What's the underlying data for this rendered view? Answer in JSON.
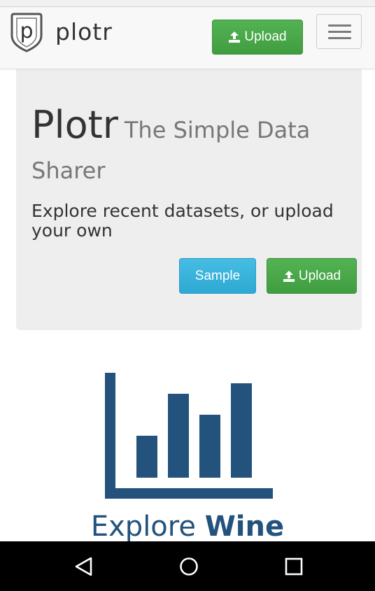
{
  "navbar": {
    "brand_name": "plotr",
    "brand_letter": "p",
    "upload_label": "Upload"
  },
  "hero": {
    "title": "Plotr",
    "subtitle": "The Simple Data Sharer",
    "lead": "Explore recent datasets, or upload your own",
    "sample_label": "Sample",
    "upload_label": "Upload"
  },
  "explore": {
    "prefix": "Explore",
    "dataset": "Wine"
  },
  "icons": {
    "brand": "shield-logo-icon",
    "upload": "upload-icon",
    "menu": "hamburger-menu-icon",
    "chart": "bar-chart-icon",
    "back": "back-triangle-icon",
    "home": "home-circle-icon",
    "recents": "recents-square-icon"
  },
  "colors": {
    "success": "#449d44",
    "info": "#31b0d5",
    "heading": "#23527c",
    "jumbotron": "#eeeeee"
  }
}
